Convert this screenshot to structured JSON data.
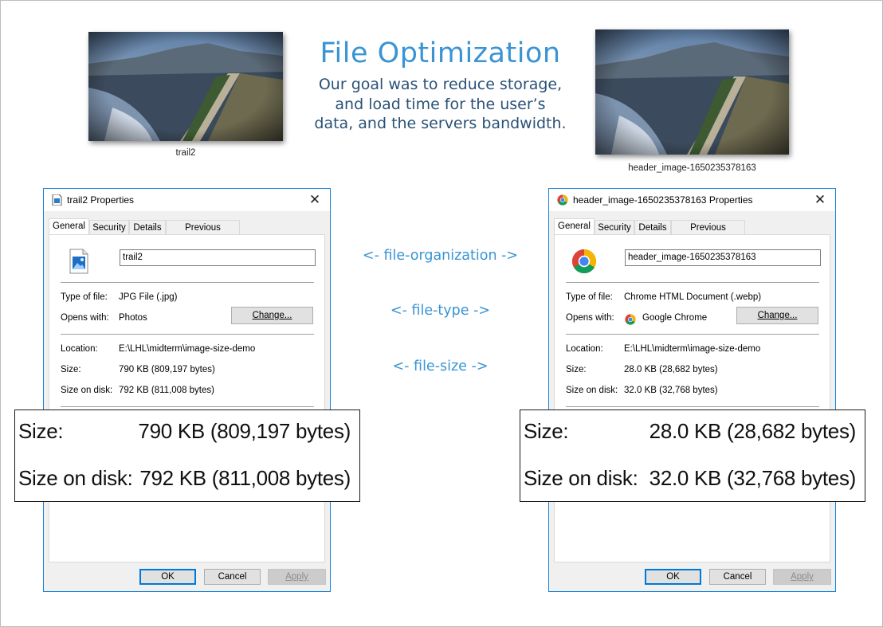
{
  "header": {
    "title": "File Optimization",
    "subtitle_lines": [
      "Our goal was to reduce storage,",
      "and load time for the user’s",
      "data, and the servers bandwidth."
    ]
  },
  "thumbnails": {
    "left_caption": "trail2",
    "right_caption": "header_image-1650235378163"
  },
  "comparisons": [
    "<- file-organization ->",
    "<- file-type ->",
    "<- file-size ->"
  ],
  "dialogs": [
    {
      "title": "trail2 Properties",
      "title_icon": "image-file-icon",
      "close_label": "✕",
      "tabs": [
        "General",
        "Security",
        "Details",
        "Previous Versions"
      ],
      "active_tab": "General",
      "file_icon": "photo-file-icon",
      "file_name": "trail2",
      "type_label": "Type of file:",
      "type_value": "JPG File (.jpg)",
      "opens_label": "Opens with:",
      "opens_value": "Photos",
      "opens_icon": "",
      "change_label": "Change...",
      "location_label": "Location:",
      "location_value": "E:\\LHL\\midterm\\image-size-demo",
      "size_label": "Size:",
      "size_value": "790 KB (809,197 bytes)",
      "disk_label": "Size on disk:",
      "disk_value": "792 KB (811,008 bytes)",
      "ok_label": "OK",
      "cancel_label": "Cancel",
      "apply_label": "Apply"
    },
    {
      "title": "header_image-1650235378163 Properties",
      "title_icon": "chrome-icon",
      "close_label": "✕",
      "tabs": [
        "General",
        "Security",
        "Details",
        "Previous Versions"
      ],
      "active_tab": "General",
      "file_icon": "chrome-icon",
      "file_name": "header_image-1650235378163",
      "type_label": "Type of file:",
      "type_value": "Chrome HTML Document (.webp)",
      "opens_label": "Opens with:",
      "opens_value": "Google Chrome",
      "opens_icon": "chrome-icon",
      "change_label": "Change...",
      "location_label": "Location:",
      "location_value": "E:\\LHL\\midterm\\image-size-demo",
      "size_label": "Size:",
      "size_value": "28.0 KB (28,682 bytes)",
      "disk_label": "Size on disk:",
      "disk_value": "32.0 KB (32,768 bytes)",
      "ok_label": "OK",
      "cancel_label": "Cancel",
      "apply_label": "Apply"
    }
  ],
  "zooms": [
    {
      "size_label": "Size:",
      "size_value": "790 KB (809,197 bytes)",
      "disk_label": "Size on disk:",
      "disk_value": "792 KB (811,008 bytes)"
    },
    {
      "size_label": "Size:",
      "size_value": "28.0 KB (28,682 bytes)",
      "disk_label": "Size on disk:",
      "disk_value": "32.0 KB (32,768 bytes)"
    }
  ],
  "colors": {
    "title_blue": "#3a94d4",
    "subtitle_navy": "#2a5177",
    "dialog_border": "#1883d7"
  }
}
